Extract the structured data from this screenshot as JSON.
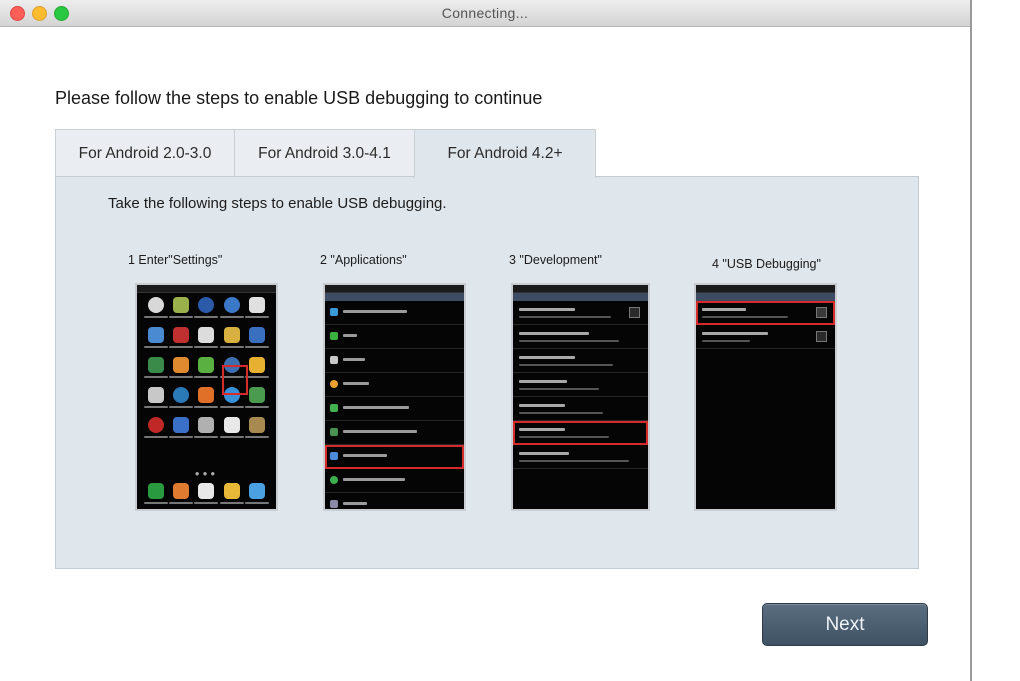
{
  "window": {
    "title": "Connecting..."
  },
  "heading": "Please follow the steps to enable USB debugging to continue",
  "tabs": [
    {
      "label": "For Android 2.0-3.0",
      "active": false
    },
    {
      "label": "For Android 3.0-4.1",
      "active": false
    },
    {
      "label": "For Android 4.2+",
      "active": true
    }
  ],
  "panel": {
    "instruction": "Take the following steps to enable USB debugging.",
    "steps": [
      {
        "label": "1 Enter\"Settings\""
      },
      {
        "label": "2 \"Applications\""
      },
      {
        "label": "3 \"Development\""
      },
      {
        "label": "4 \"USB Debugging\""
      }
    ]
  },
  "footer": {
    "next_label": "Next"
  },
  "colors": {
    "accent_button": "#4b5f71",
    "highlight": "#d52b2b",
    "panel_bg": "#dfe6ec"
  }
}
